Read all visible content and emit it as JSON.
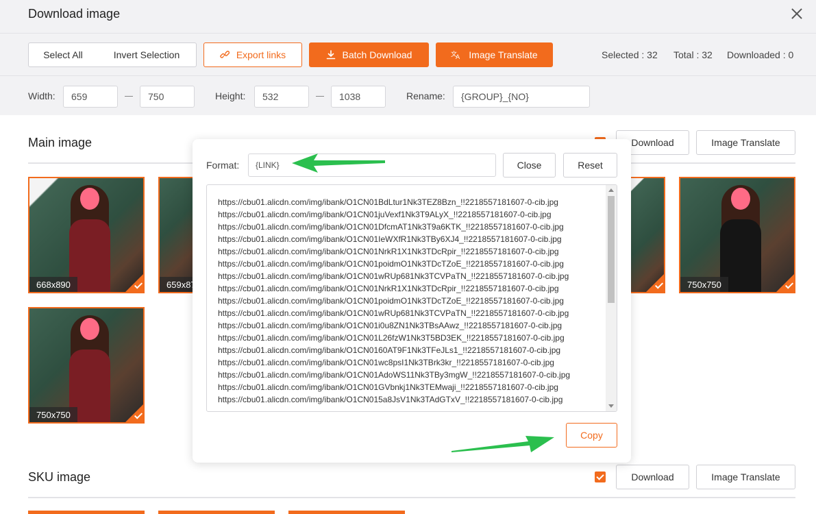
{
  "dialog": {
    "title": "Download image"
  },
  "toolbar": {
    "select_all": "Select All",
    "invert_selection": "Invert Selection",
    "export_links": "Export links",
    "batch_download": "Batch Download",
    "image_translate": "Image Translate",
    "selected": "Selected : 32",
    "total": "Total : 32",
    "downloaded": "Downloaded : 0"
  },
  "filters": {
    "width_label": "Width:",
    "width_min": "659",
    "width_max": "750",
    "height_label": "Height:",
    "height_min": "532",
    "height_max": "1038",
    "rename_label": "Rename:",
    "rename_value": "{GROUP}_{NO}"
  },
  "main_section": {
    "title": "Main image",
    "download": "Download",
    "image_translate": "Image Translate",
    "thumbnails": [
      {
        "size": "668x890",
        "selected": true
      },
      {
        "size": "659x87",
        "selected": true
      },
      {
        "size": "",
        "selected": true
      },
      {
        "size": "750x750",
        "selected": true
      },
      {
        "size": "750x750",
        "selected": true
      }
    ]
  },
  "sku_section": {
    "title": "SKU image",
    "download": "Download",
    "image_translate": "Image Translate"
  },
  "export_popup": {
    "format_label": "Format:",
    "format_value": "{LINK}",
    "close": "Close",
    "reset": "Reset",
    "copy": "Copy",
    "links": [
      "https://cbu01.alicdn.com/img/ibank/O1CN01BdLtur1Nk3TEZ8Bzn_!!2218557181607-0-cib.jpg",
      "https://cbu01.alicdn.com/img/ibank/O1CN01juVexf1Nk3T9ALyX_!!2218557181607-0-cib.jpg",
      "https://cbu01.alicdn.com/img/ibank/O1CN01DfcmAT1Nk3T9a6KTK_!!2218557181607-0-cib.jpg",
      "https://cbu01.alicdn.com/img/ibank/O1CN01IeWXfR1Nk3TBy6XJ4_!!2218557181607-0-cib.jpg",
      "https://cbu01.alicdn.com/img/ibank/O1CN01NrkR1X1Nk3TDcRpir_!!2218557181607-0-cib.jpg",
      "https://cbu01.alicdn.com/img/ibank/O1CN01poidmO1Nk3TDcTZoE_!!2218557181607-0-cib.jpg",
      "https://cbu01.alicdn.com/img/ibank/O1CN01wRUp681Nk3TCVPaTN_!!2218557181607-0-cib.jpg",
      "https://cbu01.alicdn.com/img/ibank/O1CN01NrkR1X1Nk3TDcRpir_!!2218557181607-0-cib.jpg",
      "https://cbu01.alicdn.com/img/ibank/O1CN01poidmO1Nk3TDcTZoE_!!2218557181607-0-cib.jpg",
      "https://cbu01.alicdn.com/img/ibank/O1CN01wRUp681Nk3TCVPaTN_!!2218557181607-0-cib.jpg",
      "https://cbu01.alicdn.com/img/ibank/O1CN01i0u8ZN1Nk3TBsAAwz_!!2218557181607-0-cib.jpg",
      "https://cbu01.alicdn.com/img/ibank/O1CN01L26fzW1Nk3T5BD3EK_!!2218557181607-0-cib.jpg",
      "https://cbu01.alicdn.com/img/ibank/O1CN0160AT9F1Nk3TFeJLs1_!!2218557181607-0-cib.jpg",
      "https://cbu01.alicdn.com/img/ibank/O1CN01wc8psI1Nk3TBrk3kr_!!2218557181607-0-cib.jpg",
      "https://cbu01.alicdn.com/img/ibank/O1CN01AdoWS11Nk3TBy3mgW_!!2218557181607-0-cib.jpg",
      "https://cbu01.alicdn.com/img/ibank/O1CN01GVbnkj1Nk3TEMwaji_!!2218557181607-0-cib.jpg",
      "https://cbu01.alicdn.com/img/ibank/O1CN015a8JsV1Nk3TAdGTxV_!!2218557181607-0-cib.jpg"
    ]
  },
  "colors": {
    "accent": "#f26b1d",
    "arrow": "#2bbf4e"
  },
  "icons": {
    "export": "link-icon",
    "batch": "download-icon",
    "translate": "translate-icon",
    "close": "close-icon"
  }
}
